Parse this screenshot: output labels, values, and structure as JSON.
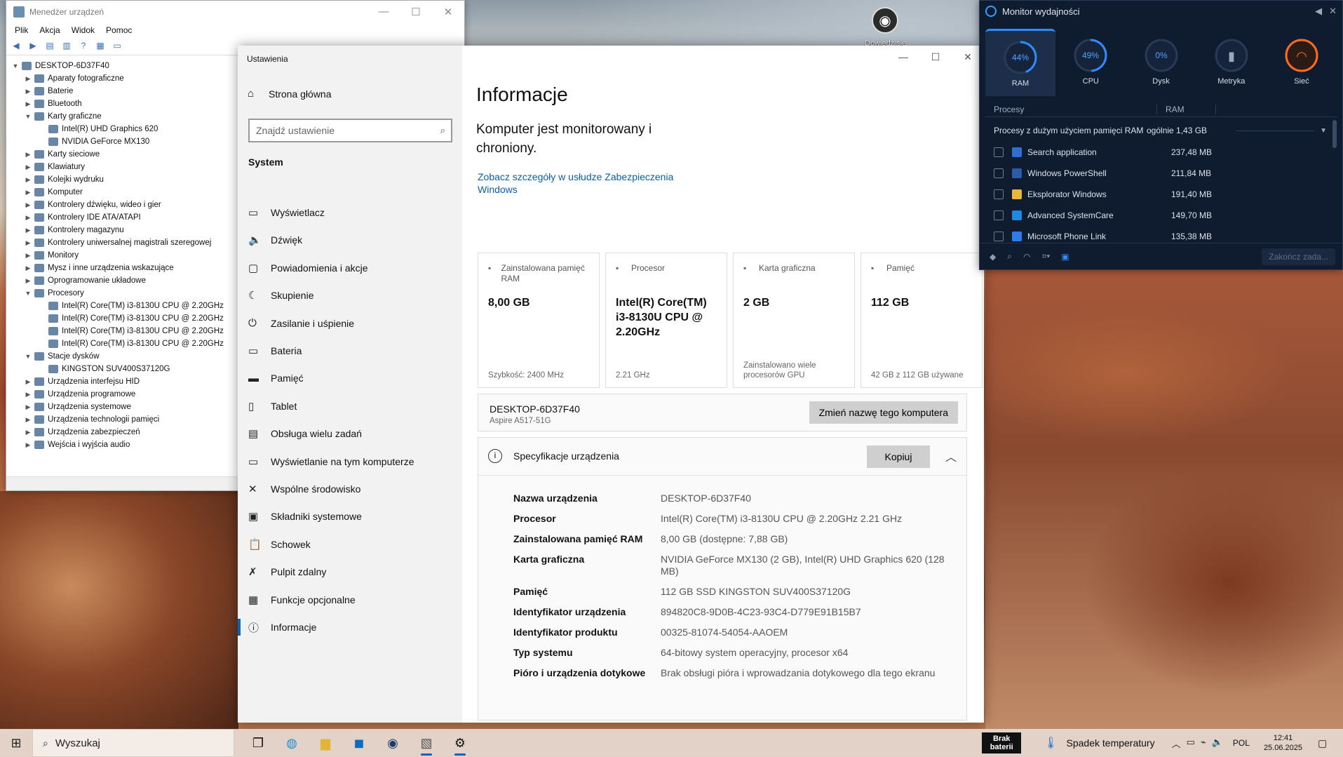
{
  "desktop": {
    "icon_label": "Dowiedz się więcej o"
  },
  "device_manager": {
    "title": "Menedżer urządzeń",
    "menu": [
      "Plik",
      "Akcja",
      "Widok",
      "Pomoc"
    ],
    "root": "DESKTOP-6D37F40",
    "tree": [
      {
        "label": "Aparaty fotograficzne",
        "level": 1,
        "expanded": false
      },
      {
        "label": "Baterie",
        "level": 1,
        "expanded": false
      },
      {
        "label": "Bluetooth",
        "level": 1,
        "expanded": false
      },
      {
        "label": "Karty graficzne",
        "level": 1,
        "expanded": true
      },
      {
        "label": "Intel(R) UHD Graphics 620",
        "level": 2
      },
      {
        "label": "NVIDIA GeForce MX130",
        "level": 2
      },
      {
        "label": "Karty sieciowe",
        "level": 1,
        "expanded": false
      },
      {
        "label": "Klawiatury",
        "level": 1,
        "expanded": false
      },
      {
        "label": "Kolejki wydruku",
        "level": 1,
        "expanded": false
      },
      {
        "label": "Komputer",
        "level": 1,
        "expanded": false
      },
      {
        "label": "Kontrolery dźwięku, wideo i gier",
        "level": 1,
        "expanded": false
      },
      {
        "label": "Kontrolery IDE ATA/ATAPI",
        "level": 1,
        "expanded": false
      },
      {
        "label": "Kontrolery magazynu",
        "level": 1,
        "expanded": false
      },
      {
        "label": "Kontrolery uniwersalnej magistrali szeregowej",
        "level": 1,
        "expanded": false
      },
      {
        "label": "Monitory",
        "level": 1,
        "expanded": false
      },
      {
        "label": "Mysz i inne urządzenia wskazujące",
        "level": 1,
        "expanded": false
      },
      {
        "label": "Oprogramowanie układowe",
        "level": 1,
        "expanded": false
      },
      {
        "label": "Procesory",
        "level": 1,
        "expanded": true
      },
      {
        "label": "Intel(R) Core(TM) i3-8130U CPU @ 2.20GHz",
        "level": 2
      },
      {
        "label": "Intel(R) Core(TM) i3-8130U CPU @ 2.20GHz",
        "level": 2
      },
      {
        "label": "Intel(R) Core(TM) i3-8130U CPU @ 2.20GHz",
        "level": 2
      },
      {
        "label": "Intel(R) Core(TM) i3-8130U CPU @ 2.20GHz",
        "level": 2
      },
      {
        "label": "Stacje dysków",
        "level": 1,
        "expanded": true
      },
      {
        "label": "KINGSTON SUV400S37120G",
        "level": 2
      },
      {
        "label": "Urządzenia interfejsu HID",
        "level": 1,
        "expanded": false
      },
      {
        "label": "Urządzenia programowe",
        "level": 1,
        "expanded": false
      },
      {
        "label": "Urządzenia systemowe",
        "level": 1,
        "expanded": false
      },
      {
        "label": "Urządzenia technologii pamięci",
        "level": 1,
        "expanded": false
      },
      {
        "label": "Urządzenia zabezpieczeń",
        "level": 1,
        "expanded": false
      },
      {
        "label": "Wejścia i wyjścia audio",
        "level": 1,
        "expanded": false
      }
    ]
  },
  "settings": {
    "app_title": "Ustawienia",
    "home": "Strona główna",
    "search_placeholder": "Znajdź ustawienie",
    "section": "System",
    "nav": [
      {
        "label": "Wyświetlacz",
        "icon": "monitor-icon",
        "glyph": "▭"
      },
      {
        "label": "Dźwięk",
        "icon": "speaker-icon",
        "glyph": "🔈"
      },
      {
        "label": "Powiadomienia i akcje",
        "icon": "notification-icon",
        "glyph": "▢"
      },
      {
        "label": "Skupienie",
        "icon": "moon-icon",
        "glyph": "☾"
      },
      {
        "label": "Zasilanie i uśpienie",
        "icon": "power-icon",
        "glyph": "⏻"
      },
      {
        "label": "Bateria",
        "icon": "battery-icon",
        "glyph": "▭"
      },
      {
        "label": "Pamięć",
        "icon": "storage-icon",
        "glyph": "▬"
      },
      {
        "label": "Tablet",
        "icon": "tablet-icon",
        "glyph": "▯"
      },
      {
        "label": "Obsługa wielu zadań",
        "icon": "multitasking-icon",
        "glyph": "▤"
      },
      {
        "label": "Wyświetlanie na tym komputerze",
        "icon": "projecting-icon",
        "glyph": "▭"
      },
      {
        "label": "Wspólne środowisko",
        "icon": "shared-icon",
        "glyph": "✕"
      },
      {
        "label": "Składniki systemowe",
        "icon": "components-icon",
        "glyph": "▣"
      },
      {
        "label": "Schowek",
        "icon": "clipboard-icon",
        "glyph": "📋"
      },
      {
        "label": "Pulpit zdalny",
        "icon": "remote-desktop-icon",
        "glyph": "✗"
      },
      {
        "label": "Funkcje opcjonalne",
        "icon": "optional-features-icon",
        "glyph": "▦"
      },
      {
        "label": "Informacje",
        "icon": "info-icon",
        "glyph": "ⓘ"
      }
    ],
    "active_index": 15,
    "page_title": "Informacje",
    "protection_text": "Komputer jest monitorowany i chroniony.",
    "security_link": "Zobacz szczegóły w usłudze Zabezpieczenia Windows",
    "cards": [
      {
        "head": "Zainstalowana pamięć RAM",
        "value": "8,00 GB",
        "sub": "Szybkość: 2400 MHz"
      },
      {
        "head": "Procesor",
        "value": "Intel(R) Core(TM) i3-8130U CPU @ 2.20GHz",
        "sub": "2.21 GHz"
      },
      {
        "head": "Karta graficzna",
        "value": "2 GB",
        "sub": "Zainstalowano wiele procesorów GPU"
      },
      {
        "head": "Pamięć",
        "value": "112 GB",
        "sub": "42 GB z 112 GB używane"
      }
    ],
    "pc_name": "DESKTOP-6D37F40",
    "pc_model": "Aspire A517-51G",
    "rename_button": "Zmień nazwę tego komputera",
    "spec_title": "Specyfikacje urządzenia",
    "copy_button": "Kopiuj",
    "specs": [
      {
        "k": "Nazwa urządzenia",
        "v": "DESKTOP-6D37F40"
      },
      {
        "k": "Procesor",
        "v": "Intel(R) Core(TM) i3-8130U CPU @ 2.20GHz   2.21 GHz"
      },
      {
        "k": "Zainstalowana pamięć RAM",
        "v": "8,00 GB (dostępne: 7,88 GB)"
      },
      {
        "k": "Karta graficzna",
        "v": "NVIDIA GeForce MX130 (2 GB), Intel(R) UHD Graphics 620 (128 MB)"
      },
      {
        "k": "Pamięć",
        "v": "112 GB SSD KINGSTON SUV400S37120G"
      },
      {
        "k": "Identyfikator urządzenia",
        "v": "894820C8-9D0B-4C23-93C4-D779E91B15B7"
      },
      {
        "k": "Identyfikator produktu",
        "v": "00325-81074-54054-AAOEM"
      },
      {
        "k": "Typ systemu",
        "v": "64-bitowy system operacyjny, procesor x64"
      },
      {
        "k": "Pióro i urządzenia dotykowe",
        "v": "Brak obsługi pióra i wprowadzania dotykowego dla tego ekranu"
      }
    ]
  },
  "perf_monitor": {
    "title": "Monitor wydajności",
    "gauges": [
      {
        "label": "RAM",
        "value": "44%",
        "pct": 44,
        "color": "#2f8cff"
      },
      {
        "label": "CPU",
        "value": "49%",
        "pct": 49,
        "color": "#2f8cff"
      },
      {
        "label": "Dysk",
        "value": "0%",
        "pct": 0,
        "color": "#2f8cff"
      },
      {
        "label": "Metryka",
        "value": "",
        "pct": 0,
        "color": "#2f8cff"
      },
      {
        "label": "Sieć",
        "value": "",
        "pct": 100,
        "color": "#ff6a1a"
      }
    ],
    "col_processes": "Procesy",
    "col_ram": "RAM",
    "group_label": "Procesy z dużym użyciem pamięci RAM",
    "group_total": "ogólnie 1,43 GB",
    "processes": [
      {
        "name": "Search application",
        "ram": "237,48 MB",
        "color": "#2f6fd0"
      },
      {
        "name": "Windows PowerShell",
        "ram": "211,84 MB",
        "color": "#2a5aa8"
      },
      {
        "name": "Eksplorator Windows",
        "ram": "191,40 MB",
        "color": "#e8b83a"
      },
      {
        "name": "Advanced SystemCare",
        "ram": "149,70 MB",
        "color": "#1e88e5"
      },
      {
        "name": "Microsoft Phone Link",
        "ram": "135,38 MB",
        "color": "#2b7de9"
      }
    ],
    "end_task": "Zakończ zada..."
  },
  "taskbar": {
    "search_label": "Wyszukaj",
    "battery_label": "Brak baterii",
    "weather": "Spadek temperatury",
    "language": "POL",
    "time": "12:41",
    "date": "25.06.2025"
  }
}
